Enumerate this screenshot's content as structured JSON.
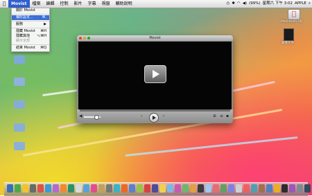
{
  "menubar": {
    "app_name": "Movist",
    "menus": [
      "檔案",
      "編輯",
      "控制",
      "影片",
      "字幕",
      "視窗",
      "輔助說明"
    ],
    "status": {
      "battery": "(99%)",
      "clock": "星期六 下午 3:02",
      "user": "APPLE"
    }
  },
  "app_menu": {
    "items": [
      {
        "label": "關於 Movist",
        "shortcut": "",
        "state": "normal"
      },
      {
        "label": "偏好設定...",
        "shortcut": "⌘,",
        "state": "selected"
      },
      {
        "label": "服務",
        "shortcut": "▶",
        "state": "normal"
      },
      {
        "label": "隱藏 Movist",
        "shortcut": "⌘H",
        "state": "normal"
      },
      {
        "label": "隱藏其他",
        "shortcut": "⌥⌘H",
        "state": "normal"
      },
      {
        "label": "顯示全部",
        "shortcut": "",
        "state": "disabled"
      },
      {
        "label": "結束 Movist",
        "shortcut": "⌘Q",
        "state": "normal"
      }
    ]
  },
  "desktop": {
    "hd_label": "Macintosh HD",
    "disk_label": "鏡像文件"
  },
  "player": {
    "title": "Movist",
    "progress": 0.0,
    "volume": 0.75
  },
  "colors": {
    "menu_highlight": "#3b6fd6",
    "video_bg": "#050505"
  }
}
